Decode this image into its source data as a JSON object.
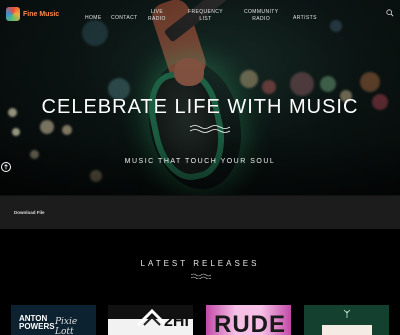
{
  "brand": {
    "name": "Fine Music"
  },
  "nav": {
    "items": [
      {
        "label": "HOME"
      },
      {
        "label": "CONTACT"
      },
      {
        "label": "LIVE\nRADIO"
      },
      {
        "label": "FREQUENCY\nLIST"
      },
      {
        "label": "COMMUNITY\nRADIO"
      },
      {
        "label": "ARTISTS"
      }
    ],
    "search_icon": "search-icon"
  },
  "hero": {
    "title": "CELEBRATE LIFE WITH MUSIC",
    "subtitle": "MUSIC THAT TOUCH YOUR SOUL",
    "scroll_icon": "arrow-up-icon"
  },
  "download": {
    "label": "Download File"
  },
  "releases": {
    "title": "LATEST RELEASES",
    "covers": [
      {
        "line1": "ANTON",
        "line2": "POWERS",
        "line3": "Pixie Lott",
        "bg": "#0d2230"
      },
      {
        "line1": "2HI",
        "line2": "",
        "line3": "",
        "bg": "#ffffff"
      },
      {
        "line1": "RUDE",
        "line2": "",
        "line3": "",
        "bg": "#d85fb8"
      },
      {
        "line1": "",
        "line2": "",
        "line3": "",
        "bg": "#14402f"
      }
    ]
  },
  "colors": {
    "accent": "#ff8a4a",
    "guitar_glow": "#2a8c63",
    "background": "#000000"
  }
}
